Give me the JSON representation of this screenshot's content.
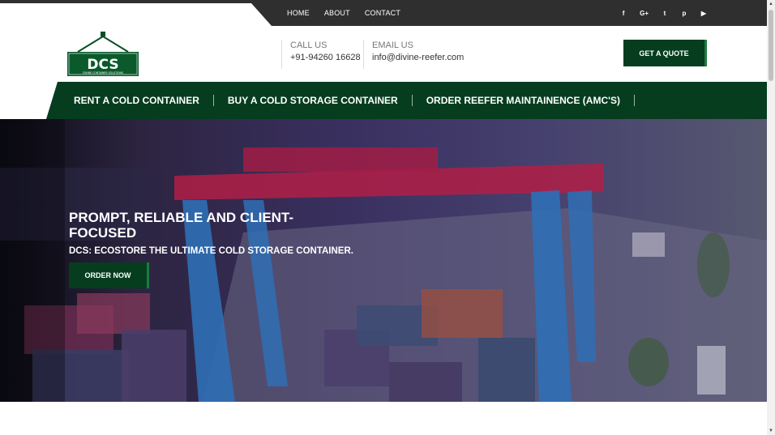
{
  "topbar": {
    "nav": [
      {
        "label": "HOME"
      },
      {
        "label": "ABOUT"
      },
      {
        "label": "CONTACT"
      }
    ],
    "social": [
      {
        "icon": "facebook-icon",
        "glyph": "f"
      },
      {
        "icon": "google-plus-icon",
        "glyph": "G+"
      },
      {
        "icon": "twitter-icon",
        "glyph": "t"
      },
      {
        "icon": "pinterest-icon",
        "glyph": "p"
      },
      {
        "icon": "youtube-icon",
        "glyph": "▶"
      }
    ]
  },
  "header": {
    "logo": {
      "text": "DCS",
      "tagline": "DIVINE CONTAINER SOLUTIONS"
    },
    "call": {
      "label": "CALL US",
      "value": "+91-94260 16628"
    },
    "email": {
      "label": "EMAIL US",
      "value": "info@divine-reefer.com"
    },
    "quote_label": "GET A QUOTE"
  },
  "mainnav": [
    {
      "label": "RENT A COLD CONTAINER"
    },
    {
      "label": "BUY A COLD STORAGE CONTAINER"
    },
    {
      "label": "ORDER REEFER MAINTAINENCE (AMC'S)"
    }
  ],
  "hero": {
    "title": "PROMPT, RELIABLE AND CLIENT-FOCUSED",
    "subtitle": "DCS: ECOSTORE THE ULTIMATE COLD STORAGE CONTAINER.",
    "button_label": "ORDER NOW"
  },
  "colors": {
    "brand_green": "#063d1f",
    "topbar": "#2f2f2f"
  }
}
